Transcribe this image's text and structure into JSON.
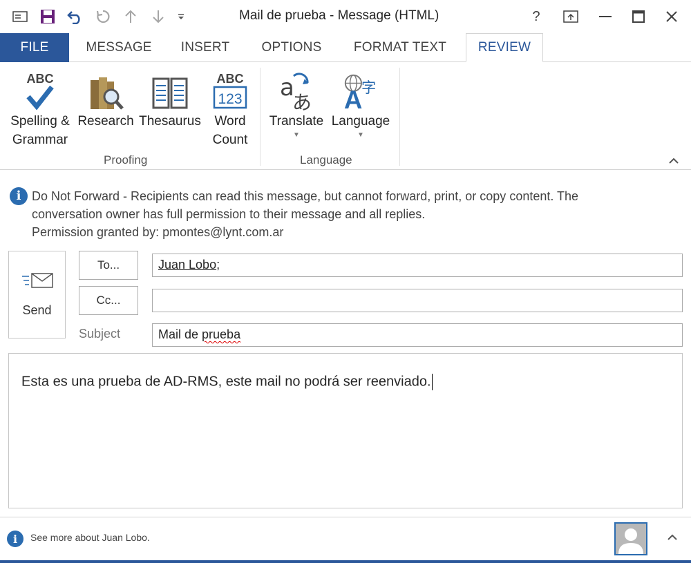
{
  "window": {
    "title": "Mail de prueba - Message (HTML)"
  },
  "qat": {
    "icons": [
      "mail-icon",
      "save-icon",
      "undo-icon",
      "redo-icon",
      "up-arrow-icon",
      "down-arrow-icon",
      "customize-icon"
    ]
  },
  "window_controls": {
    "help": "?",
    "restore": "❐",
    "minimize": "—",
    "maximize": "☐",
    "close": "✕"
  },
  "tabs": [
    {
      "label": "FILE"
    },
    {
      "label": "MESSAGE"
    },
    {
      "label": "INSERT"
    },
    {
      "label": "OPTIONS"
    },
    {
      "label": "FORMAT TEXT"
    },
    {
      "label": "REVIEW"
    }
  ],
  "ribbon": {
    "groups": {
      "proofing": "Proofing",
      "language": "Language"
    },
    "buttons": {
      "spelling_1": "Spelling &",
      "spelling_2": "Grammar",
      "research": "Research",
      "thesaurus": "Thesaurus",
      "wordcount_1": "Word",
      "wordcount_2": "Count",
      "translate": "Translate",
      "language": "Language",
      "abc": "ABC",
      "num": "123"
    }
  },
  "infobar": {
    "line1": "Do Not Forward - Recipients can read this message, but cannot forward, print, or copy content. The",
    "line2": "conversation owner has full permission to their message and all replies.",
    "line3": "Permission granted by: pmontes@lynt.com.ar"
  },
  "compose": {
    "send_label": "Send",
    "to_label": "To...",
    "cc_label": "Cc...",
    "subject_label": "Subject",
    "to_value": "Juan Lobo",
    "to_suffix": ";",
    "cc_value": "",
    "subject_prefix": "Mail de ",
    "subject_word": "prueba",
    "body": "Esta es una prueba de AD-RMS, este mail no podrá ser reenviado."
  },
  "people_pane": {
    "text": "See more about Juan Lobo."
  },
  "colors": {
    "accent": "#2b579a",
    "info_icon": "#2b6cb0"
  }
}
